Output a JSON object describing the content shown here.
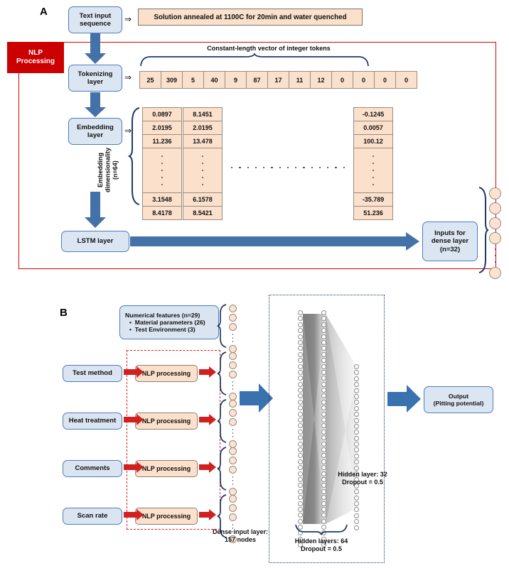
{
  "figure": {
    "panel_a_letter": "A",
    "panel_b_letter": "B"
  },
  "panel_a": {
    "text_input_box": "Text input\nsequence",
    "example_sentence": "Solution annealed at 1100C for 20min and water quenched",
    "nlp_tag": "NLP\nProcessing",
    "tokenizing_box": "Tokenizing\nlayer",
    "token_vector_caption": "Constant-length vector of integer tokens",
    "tokens": [
      "25",
      "309",
      "5",
      "40",
      "9",
      "87",
      "17",
      "11",
      "12",
      "0",
      "0",
      "0",
      "0"
    ],
    "embedding_box": "Embedding\nlayer",
    "embedding_dim_label": "Embedding\ndimensionality\n(n=64)",
    "embedding_columns": [
      [
        "0.0897",
        "2.0195",
        "11.236",
        "3.1548",
        "8.4178"
      ],
      [
        "8.1451",
        "2.0195",
        "13.478",
        "6.1578",
        "8.5421"
      ],
      [
        "-0.1245",
        "0.0057",
        "100.12",
        "-35.789",
        "51.236"
      ]
    ],
    "lstm_box": "LSTM layer",
    "dense_inputs_box": "Inputs for\ndense layer\n(n=32)",
    "arrow_glyph": "⇒"
  },
  "panel_b": {
    "numerical_features": {
      "title": "Numerical features (n=29)",
      "bullets": [
        "Material parameters (26)",
        "Test Environment (3)"
      ]
    },
    "text_inputs": [
      "Test method",
      "Heat treatment",
      "Comments",
      "Scan rate"
    ],
    "nlp_label": "NLP processing",
    "dense_input_caption": "Dense input layer:\n157 nodes",
    "hidden_layer_32_caption": "Hidden layer: 32\nDropout = 0.5",
    "hidden_layers_64_caption": "Hidden layers: 64\nDropout = 0.5",
    "output_box": "Output\n(Pitting potential)"
  },
  "colors": {
    "blue_box_fill": "#dce6f2",
    "blue_box_border": "#4a7ebb",
    "peach_fill": "#fbe0cb",
    "red_tag": "#cc0000",
    "red_frame": "#e00000",
    "arrow_blue": "#4472a8",
    "arrow_red": "#d02020",
    "brace_navy": "#1f3864",
    "node_fill": "#fbe3d2"
  }
}
